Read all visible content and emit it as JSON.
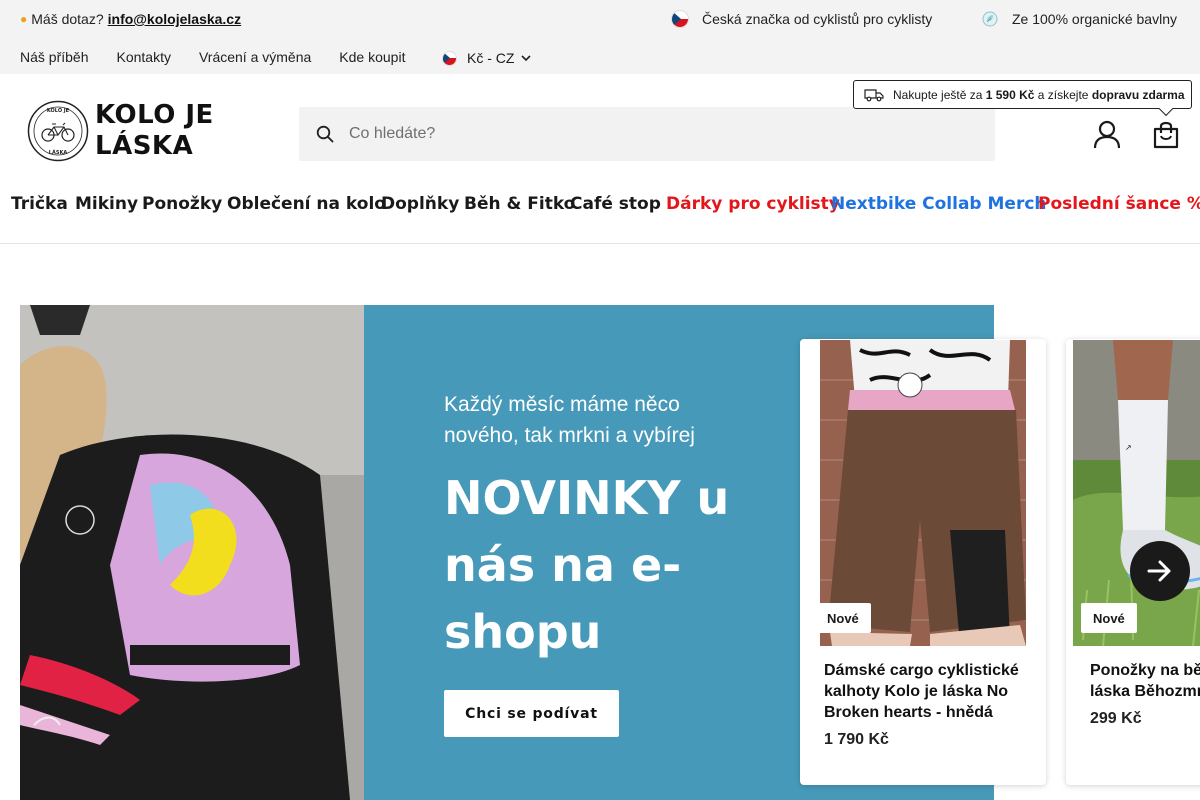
{
  "topbar": {
    "question_label": "Máš dotaz?",
    "email": "info@kolojelaska.cz",
    "trust_1": "Česká značka od cyklistů pro cyklisty",
    "trust_2": "Ze 100% organické bavlny"
  },
  "subnav": {
    "items": [
      "Náš příběh",
      "Kontakty",
      "Vrácení a výměna",
      "Kde koupit"
    ],
    "currency": "Kč - CZ"
  },
  "header": {
    "logo_line1": "KOLO JE",
    "logo_line2": "LÁSKA",
    "badge_top": "KOLO JE",
    "badge_bottom": "LÁSKA",
    "search_placeholder": "Co hledáte?",
    "shipping_pre": "Nakupte ještě za",
    "shipping_amount": "1 590 Kč",
    "shipping_mid": "a získejte",
    "shipping_free": "dopravu zdarma"
  },
  "categories": [
    {
      "label": "Trička",
      "color": "#1a1a1a"
    },
    {
      "label": "Mikiny",
      "color": "#1a1a1a"
    },
    {
      "label": "Ponožky",
      "color": "#1a1a1a"
    },
    {
      "label": "Oblečení na kolo",
      "color": "#1a1a1a"
    },
    {
      "label": "Doplňky",
      "color": "#1a1a1a"
    },
    {
      "label": "Běh & Fitko",
      "color": "#1a1a1a"
    },
    {
      "label": "Café stop",
      "color": "#1a1a1a"
    },
    {
      "label": "Dárky pro cyklisty",
      "color": "#e3171b"
    },
    {
      "label": "Nextbike Collab Merch",
      "color": "#1e73e0"
    },
    {
      "label": "Poslední šance %",
      "color": "#e3171b"
    }
  ],
  "hero": {
    "subtitle": "Každý měsíc máme něco nového, tak mrkni a vybírej",
    "title": "NOVINKY u nás na e-shopu",
    "cta": "Chci se podívat",
    "panel_color": "#4699b8"
  },
  "products": [
    {
      "badge": "Nové",
      "name": "Dámské cargo cyklistické kalhoty Kolo je láska No Broken hearts - hnědá",
      "price": "1 790 Kč"
    },
    {
      "badge": "Nové",
      "name": "Ponožky na běh Kolo je láska Běhozmrd",
      "name_visible": "Ponožky na bě",
      "name_visible_2": "láska Běhozmr",
      "price": "299 Kč"
    }
  ]
}
